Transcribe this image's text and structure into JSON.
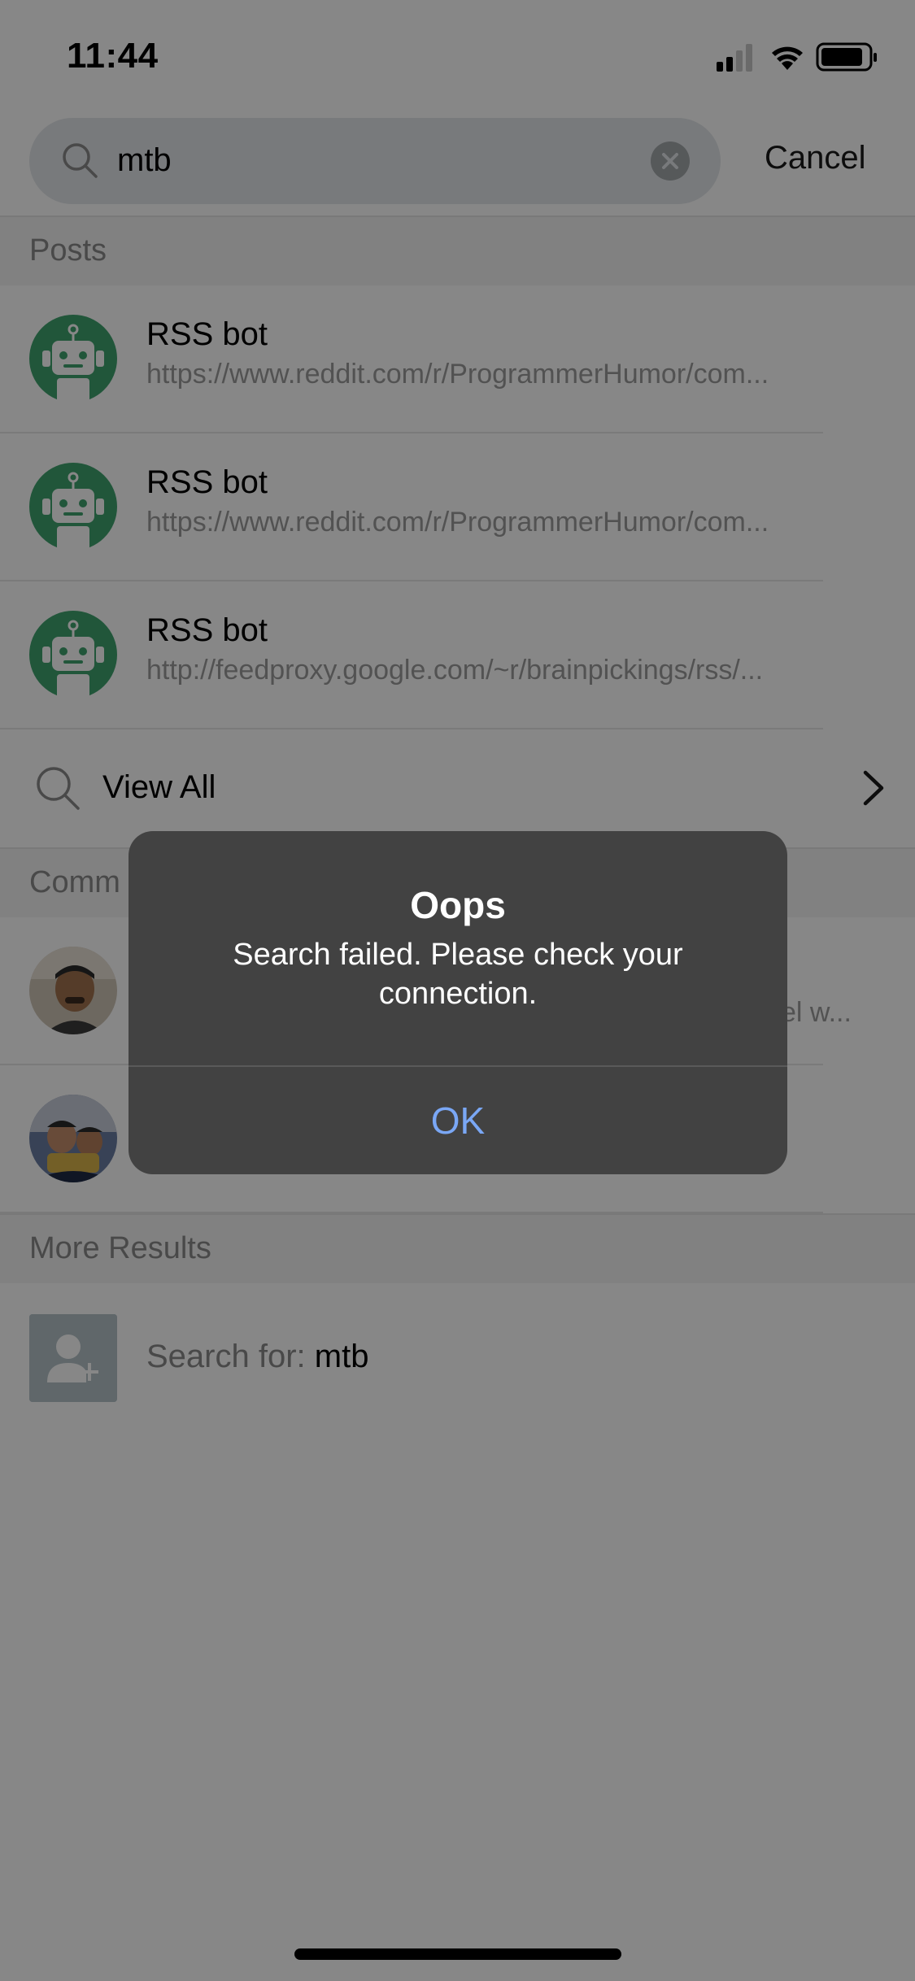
{
  "status_bar": {
    "time": "11:44"
  },
  "search": {
    "query": "mtb",
    "cancel_label": "Cancel"
  },
  "sections": {
    "posts": "Posts",
    "comments": "Comm",
    "more_results": "More Results"
  },
  "posts": [
    {
      "title": "RSS bot",
      "url": "https://www.reddit.com/r/ProgrammerHumor/com..."
    },
    {
      "title": "RSS bot",
      "url": "https://www.reddit.com/r/ProgrammerHumor/com..."
    },
    {
      "title": "RSS bot",
      "url": "http://feedproxy.google.com/~r/brainpickings/rss/..."
    }
  ],
  "view_all_label": "View All",
  "comments": [
    {
      "tail": "el w..."
    }
  ],
  "more_results": {
    "search_for_label": "Search for:",
    "query": "mtb"
  },
  "alert": {
    "title": "Oops",
    "message": "Search failed. Please check your connection.",
    "ok_label": "OK"
  },
  "colors": {
    "accent": "#7aa7f5",
    "bot_green": "#3fa36e"
  }
}
